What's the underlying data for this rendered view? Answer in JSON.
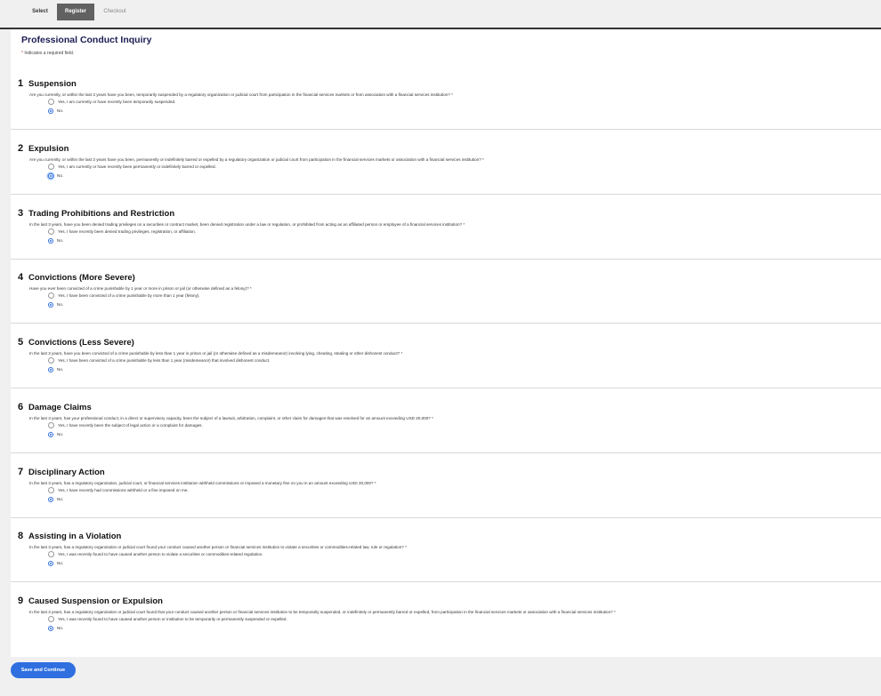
{
  "tabs": [
    {
      "label": "Select",
      "state": "normal"
    },
    {
      "label": "Register",
      "state": "active"
    },
    {
      "label": "Checkout",
      "state": "disabled"
    }
  ],
  "page": {
    "title": "Professional Conduct Inquiry",
    "required_star": "*",
    "required_note": " Indicates a required field."
  },
  "sections": [
    {
      "number": "1",
      "title": "Suspension",
      "question": "Are you currently, or within the last 3 years have you been, temporarily suspended by a regulatory organization or judicial court from participation in the financial services markets or from association with a financial services institution? *",
      "options": [
        {
          "label": "Yes, I am currently or have recently been temporarily suspended.",
          "selected": false
        },
        {
          "label": "No.",
          "selected": true
        }
      ]
    },
    {
      "number": "2",
      "title": "Expulsion",
      "question": "Are you currently, or within the last 3 years have you been, permanently or indefinitely barred or expelled by a regulatory organization or judicial court from participation in the financial services markets or association with a financial services institution? *",
      "options": [
        {
          "label": "Yes, I am currently or have recently been permanently or indefinitely barred or expelled.",
          "selected": false
        },
        {
          "label": "No.",
          "selected": true,
          "focused": true
        }
      ]
    },
    {
      "number": "3",
      "title": "Trading Prohibitions and Restriction",
      "question": "In the last 3 years, have you been denied trading privileges on a securities or contract market, been denied registration under a law or regulation, or prohibited from acting as an affiliated person or employee of a financial services institution? *",
      "options": [
        {
          "label": "Yes, I have recently been denied trading privileges, registration, or affiliation.",
          "selected": false
        },
        {
          "label": "No.",
          "selected": true
        }
      ]
    },
    {
      "number": "4",
      "title": "Convictions (More Severe)",
      "question": "Have you ever been convicted of a crime punishable by 1 year or more in prison or jail (or otherwise defined as a felony)? *",
      "options": [
        {
          "label": "Yes, I have been convicted of a crime punishable by more than 1 year (felony).",
          "selected": false
        },
        {
          "label": "No.",
          "selected": true
        }
      ]
    },
    {
      "number": "5",
      "title": "Convictions (Less Severe)",
      "question": "In the last 3 years, have you been convicted of a crime punishable by less than 1 year in prison or jail (or otherwise defined as a misdemeanor) involving lying, cheating, stealing or other dishonest conduct? *",
      "options": [
        {
          "label": "Yes, I have been convicted of a crime punishable by less than 1 year (misdemeanor) that involved dishonest conduct.",
          "selected": false
        },
        {
          "label": "No.",
          "selected": true
        }
      ]
    },
    {
      "number": "6",
      "title": "Damage Claims",
      "question": "In the last 3 years, has your professional conduct, in a direct or supervisory capacity, been the subject of a lawsuit, arbitration, complaint, or other claim for damages that was resolved for an amount exceeding USD 20,000? *",
      "options": [
        {
          "label": "Yes, I have recently been the subject of legal action or a complaint for damages.",
          "selected": false
        },
        {
          "label": "No.",
          "selected": true
        }
      ]
    },
    {
      "number": "7",
      "title": "Disciplinary Action",
      "question": "In the last 3 years, has a regulatory organization, judicial court, or financial services institution withheld commissions or imposed a monetary fine on you in an amount exceeding USD 20,000? *",
      "options": [
        {
          "label": "Yes, I have recently had commissions withheld or a fine imposed on me.",
          "selected": false
        },
        {
          "label": "No.",
          "selected": true
        }
      ]
    },
    {
      "number": "8",
      "title": "Assisting in a Violation",
      "question": "In the last 3 years, has a regulatory organization or judicial court found your conduct caused another person or financial services institution to violate a securities or commodities-related law, rule or regulation? *",
      "options": [
        {
          "label": "Yes, I was recently found to have caused another person to violate a securities or commodities-related regulation.",
          "selected": false
        },
        {
          "label": "No.",
          "selected": true
        }
      ]
    },
    {
      "number": "9",
      "title": "Caused Suspension or Expulsion",
      "question": "In the last 3 years, has a regulatory organization or judicial court found that your conduct caused another person or financial services institution to be temporarily suspended, or indefinitely or permanently barred or expelled, from participation in the financial services markets or association with a financial services institution? *",
      "options": [
        {
          "label": "Yes, I was recently found to have caused another person or institution to be temporarily or permanently suspended or expelled.",
          "selected": false
        },
        {
          "label": "No.",
          "selected": true
        }
      ]
    }
  ],
  "actions": {
    "save_label": "Save and Continue"
  },
  "colors": {
    "accent": "#2f6fe0",
    "title": "#1c1c54",
    "active_tab": "#616161"
  }
}
